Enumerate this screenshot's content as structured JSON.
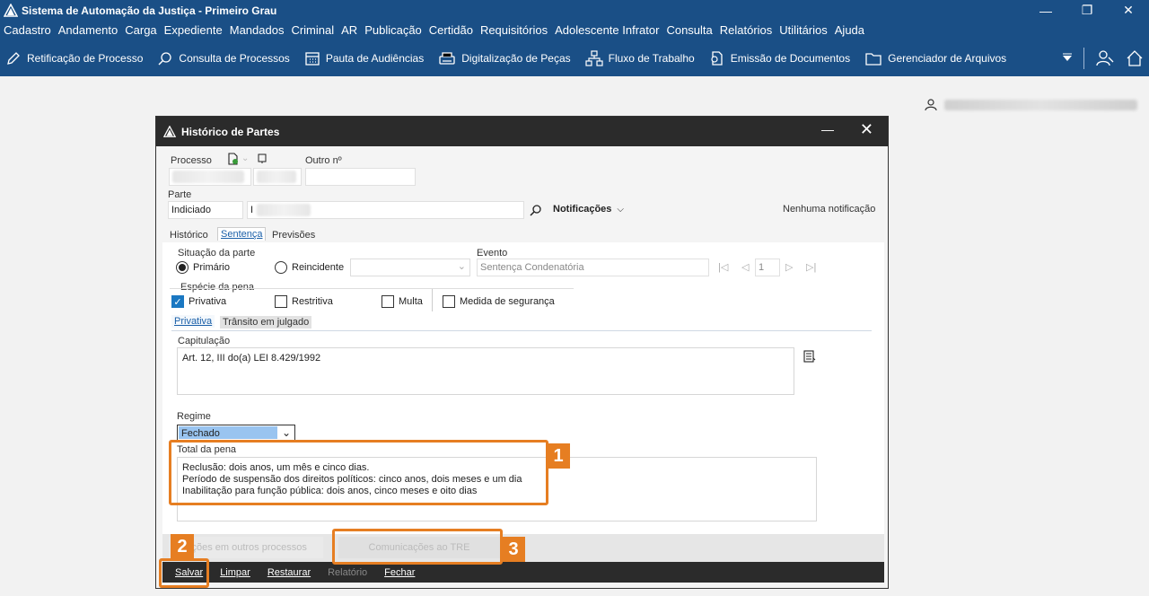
{
  "app": {
    "title": "Sistema de Automação da Justiça - Primeiro Grau",
    "menu": [
      "Cadastro",
      "Andamento",
      "Carga",
      "Expediente",
      "Mandados",
      "Criminal",
      "AR",
      "Publicação",
      "Certidão",
      "Requisitórios",
      "Adolescente Infrator",
      "Consulta",
      "Relatórios",
      "Utilitários",
      "Ajuda"
    ],
    "toolbar": [
      {
        "label": "Retificação de Processo",
        "icon": "pencil-icon"
      },
      {
        "label": "Consulta de Processos",
        "icon": "search-icon"
      },
      {
        "label": "Pauta de Audiências",
        "icon": "calendar-icon"
      },
      {
        "label": "Digitalização de Peças",
        "icon": "scanner-icon"
      },
      {
        "label": "Fluxo de Trabalho",
        "icon": "workflow-icon"
      },
      {
        "label": "Emissão de Documentos",
        "icon": "document-icon"
      },
      {
        "label": "Gerenciador de Arquivos",
        "icon": "folder-icon"
      }
    ]
  },
  "dialog": {
    "title": "Histórico de Partes",
    "processo_label": "Processo",
    "outro_label": "Outro nº",
    "parte_label": "Parte",
    "parte_tipo": "Indiciado",
    "parte_nome": "I",
    "notificacoes_label": "Notificações",
    "notificacao_status": "Nenhuma notificação",
    "tabs": [
      "Histórico",
      "Sentença",
      "Previsões"
    ],
    "situacao_label": "Situação da parte",
    "primario": "Primário",
    "reincidente": "Reincidente",
    "evento_label": "Evento",
    "evento_value": "Sentença Condenatória",
    "evento_page": "1",
    "especie_label": "Espécie da pena",
    "especies": [
      {
        "label": "Privativa",
        "checked": true
      },
      {
        "label": "Restritiva",
        "checked": false
      },
      {
        "label": "Multa",
        "checked": false
      },
      {
        "label": "Medida de segurança",
        "checked": false
      }
    ],
    "subtabs": [
      "Privativa",
      "Trânsito em julgado"
    ],
    "capitulacao_label": "Capitulação",
    "capitulacao_value": "Art. 12, III do(a) LEI 8.429/1992",
    "regime_label": "Regime",
    "regime_value": "Fechado",
    "total_label": "Total da pena",
    "total_lines": [
      "Reclusão: dois anos, um mês e cinco dias.",
      "Período de suspensão dos direitos políticos: cinco anos, dois meses e um dia",
      "Inabilitação para função pública: dois anos, cinco meses e oito dias"
    ],
    "btn_outros": "Ações em outros processos",
    "btn_tre": "Comunicações ao TRE",
    "actions": [
      {
        "label": "Salvar",
        "enabled": true
      },
      {
        "label": "Limpar",
        "enabled": true
      },
      {
        "label": "Restaurar",
        "enabled": true
      },
      {
        "label": "Relatório",
        "enabled": false
      },
      {
        "label": "Fechar",
        "enabled": true
      }
    ]
  },
  "callouts": [
    "1",
    "2",
    "3"
  ],
  "colors": {
    "accent": "#1a4f86",
    "callout": "#e67e22",
    "dialog_bar": "#2b2b2b"
  }
}
